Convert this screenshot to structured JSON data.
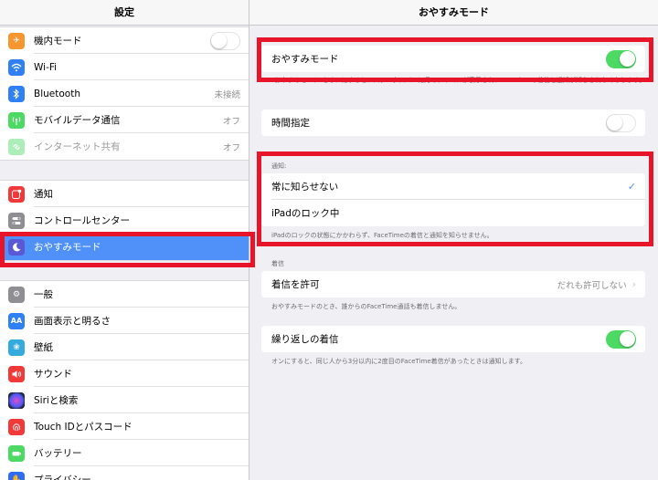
{
  "sidebar": {
    "title": "設定",
    "group1": [
      {
        "label": "機内モード",
        "icon": "airplane-icon",
        "color": "#f7962f",
        "type": "toggle",
        "on": false
      },
      {
        "label": "Wi-Fi",
        "icon": "wifi-icon",
        "color": "#2f80f6",
        "value": ""
      },
      {
        "label": "Bluetooth",
        "icon": "bluetooth-icon",
        "color": "#2f80f6",
        "value": "未接続"
      },
      {
        "label": "モバイルデータ通信",
        "icon": "antenna-icon",
        "color": "#4cd964",
        "value": "オフ"
      },
      {
        "label": "インターネット共有",
        "icon": "hotspot-icon",
        "color": "#4cd964",
        "value": "オフ",
        "dim": true
      }
    ],
    "group2": [
      {
        "label": "通知",
        "icon": "notifications-icon",
        "color": "#f2393a"
      },
      {
        "label": "コントロールセンター",
        "icon": "control-center-icon",
        "color": "#8e8e93"
      },
      {
        "label": "おやすみモード",
        "icon": "moon-icon",
        "color": "#5b58d6",
        "selected": true
      }
    ],
    "group3": [
      {
        "label": "一般",
        "icon": "gear-icon",
        "color": "#8e8e93"
      },
      {
        "label": "画面表示と明るさ",
        "icon": "display-icon",
        "color": "#2f80f6"
      },
      {
        "label": "壁紙",
        "icon": "wallpaper-icon",
        "color": "#35aadc"
      },
      {
        "label": "サウンド",
        "icon": "sound-icon",
        "color": "#f2393a"
      },
      {
        "label": "Siriと検索",
        "icon": "siri-icon",
        "color": "#222233"
      },
      {
        "label": "Touch IDとパスコード",
        "icon": "fingerprint-icon",
        "color": "#f2393a"
      },
      {
        "label": "バッテリー",
        "icon": "battery-icon",
        "color": "#4cd964"
      },
      {
        "label": "プライバシー",
        "icon": "hand-icon",
        "color": "#2f6cf6"
      }
    ]
  },
  "main": {
    "title": "おやすみモード",
    "dnd": {
      "label": "おやすみモード",
      "on": true,
      "note": "\"おやすみモード\"をオンにすると、ステータスバーに月のアイコンが表示され、FaceTimeの着信と通知が知らされなくなります。"
    },
    "scheduled": {
      "label": "時間指定",
      "on": false
    },
    "silence": {
      "header": "通知:",
      "always": "常に知らせない",
      "always_check": "✓",
      "locked": "iPadのロック中",
      "note": "iPadのロックの状態にかかわらず、FaceTimeの着信と通知を知らせません。"
    },
    "phone": {
      "header": "着信",
      "allow_label": "着信を許可",
      "allow_value": "だれも許可しない",
      "allow_note": "おやすみモードのとき、誰からのFaceTime通話も着信しません。",
      "repeated_label": "繰り返しの着信",
      "repeated_on": true,
      "repeated_note": "オンにすると、同じ人から3分以内に2度目のFaceTime着信があったときは通知します。"
    }
  }
}
